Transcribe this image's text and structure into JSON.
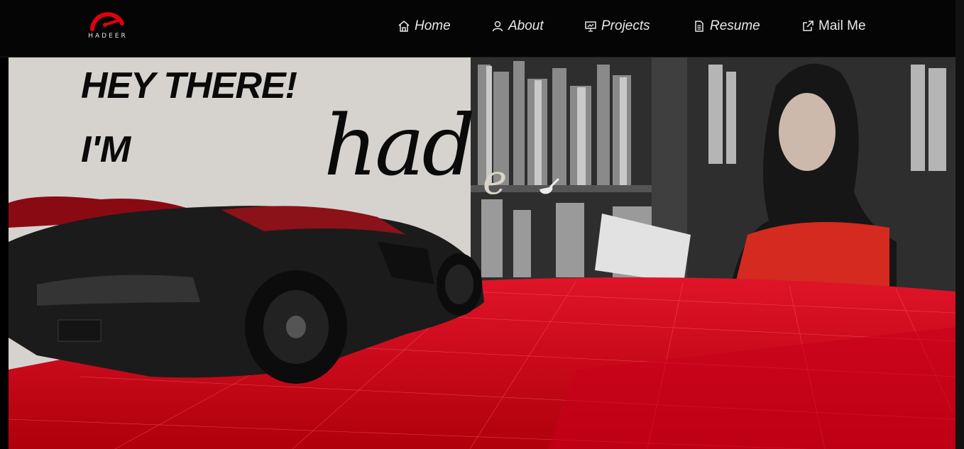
{
  "brand": {
    "logo_text": "HADEER"
  },
  "nav": {
    "items": [
      {
        "label": "Home",
        "icon": "home-icon"
      },
      {
        "label": "About",
        "icon": "user-icon"
      },
      {
        "label": "Projects",
        "icon": "presentation-icon"
      },
      {
        "label": "Resume",
        "icon": "document-icon"
      },
      {
        "label": "Mail Me",
        "icon": "external-link-icon"
      }
    ]
  },
  "hero": {
    "greeting": "HEY THERE!",
    "intro": "I'M",
    "name_visible": "had",
    "name_partial": "e"
  },
  "colors": {
    "accent": "#c40010",
    "nav_bg": "#050505",
    "left_panel": "#d6d3cf"
  }
}
